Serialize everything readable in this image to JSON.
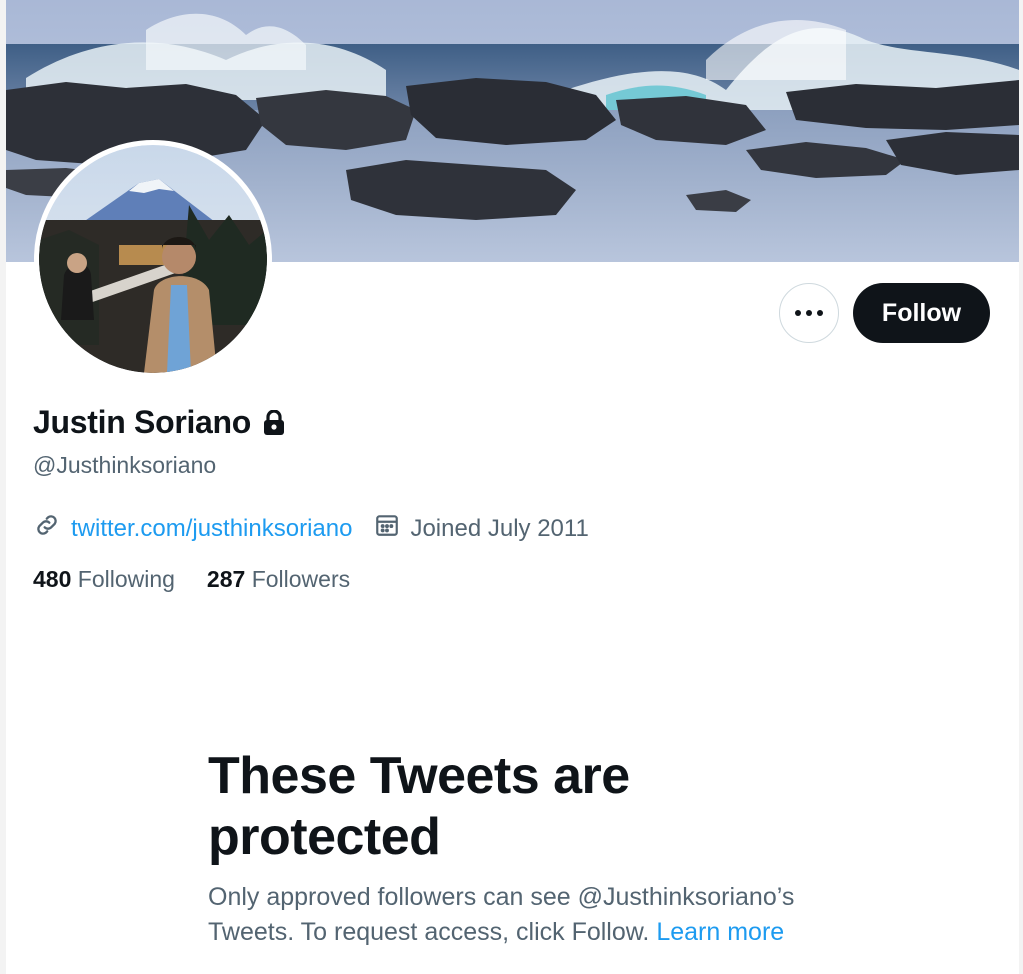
{
  "profile": {
    "display_name": "Justin Soriano",
    "handle": "@Justhinksoriano",
    "website": "twitter.com/justhinksoriano",
    "joined": "Joined July 2011",
    "following_count": "480",
    "following_label": "Following",
    "followers_count": "287",
    "followers_label": "Followers",
    "protected": true
  },
  "actions": {
    "follow_label": "Follow",
    "more_icon": "more-horizontal-icon"
  },
  "protected_notice": {
    "title": "These Tweets are protected",
    "description": "Only approved followers can see @Justhinksoriano’s Tweets. To request access, click Follow.",
    "learn_more": "Learn more"
  },
  "colors": {
    "text_primary": "#0f1419",
    "text_secondary": "#536471",
    "link": "#1d9bf0",
    "follow_button_bg": "#0f1419"
  }
}
